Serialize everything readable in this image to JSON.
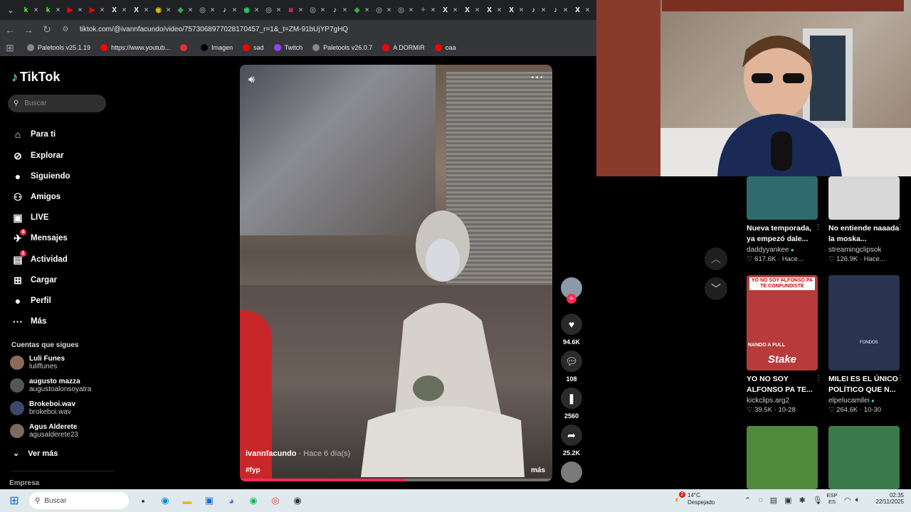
{
  "browser": {
    "tabs": [
      {
        "icon": "k",
        "color": "#53fc18"
      },
      {
        "icon": "k",
        "color": "#53fc18"
      },
      {
        "icon": "▶",
        "color": "#ff0000"
      },
      {
        "icon": "▶",
        "color": "#ff0000"
      },
      {
        "icon": "X",
        "color": "#000"
      },
      {
        "icon": "X",
        "color": "#000"
      },
      {
        "icon": "◉",
        "color": "#e0c000"
      },
      {
        "icon": "◆",
        "color": "#2db34a"
      },
      {
        "icon": "◎",
        "color": "#888"
      },
      {
        "icon": "♪",
        "color": "#000"
      },
      {
        "icon": "◉",
        "color": "#25d366"
      },
      {
        "icon": "◎",
        "color": "#888"
      },
      {
        "icon": "◙",
        "color": "#d62976"
      },
      {
        "icon": "◎",
        "color": "#888"
      },
      {
        "icon": "♪",
        "color": "#000"
      },
      {
        "icon": "◆",
        "color": "#2db34a"
      },
      {
        "icon": "◎",
        "color": "#888"
      },
      {
        "icon": "◎",
        "color": "#888"
      },
      {
        "icon": "✦",
        "color": "#666"
      },
      {
        "icon": "X",
        "color": "#000"
      },
      {
        "icon": "X",
        "color": "#000"
      },
      {
        "icon": "X",
        "color": "#000"
      },
      {
        "icon": "X",
        "color": "#000"
      },
      {
        "icon": "♪",
        "color": "#000"
      },
      {
        "icon": "♪",
        "color": "#000"
      },
      {
        "icon": "X",
        "color": "#000"
      }
    ],
    "url": "tiktok.com/@ivannfacundo/video/7573068977028170457_r=1&_t=ZM-91bUjYP7gHQ",
    "bookmarks": [
      {
        "label": "Paletools v25.1.19",
        "color": "#888"
      },
      {
        "label": "https://www.youtub...",
        "color": "#ff0000"
      },
      {
        "label": "",
        "color": "#e03030"
      },
      {
        "label": "Imagen",
        "color": "#000"
      },
      {
        "label": "sad",
        "color": "#ff0000"
      },
      {
        "label": "Twitch",
        "color": "#9146ff"
      },
      {
        "label": "Paletools v26.0.7",
        "color": "#888"
      },
      {
        "label": "A DORMIR",
        "color": "#ff0000"
      },
      {
        "label": "oaa",
        "color": "#ff0000"
      }
    ]
  },
  "sidebar": {
    "logo": "TikTok",
    "search_placeholder": "Buscar",
    "nav": [
      {
        "label": "Para ti",
        "icon": "⌂",
        "name": "home"
      },
      {
        "label": "Explorar",
        "icon": "⊘",
        "name": "explore"
      },
      {
        "label": "Siguiendo",
        "icon": "●",
        "name": "following"
      },
      {
        "label": "Amigos",
        "icon": "⚇",
        "name": "friends"
      },
      {
        "label": "LIVE",
        "icon": "▣",
        "name": "live"
      },
      {
        "label": "Mensajes",
        "icon": "✈",
        "name": "messages",
        "badge": "4"
      },
      {
        "label": "Actividad",
        "icon": "▤",
        "name": "activity",
        "badge": "1"
      },
      {
        "label": "Cargar",
        "icon": "⊞",
        "name": "upload"
      },
      {
        "label": "Perfil",
        "icon": "●",
        "name": "profile"
      },
      {
        "label": "Más",
        "icon": "···",
        "name": "more"
      }
    ],
    "following_title": "Cuentas que sigues",
    "accounts": [
      {
        "name": "Luli Funes",
        "handle": "luliffunes",
        "color": "#8a6a5a"
      },
      {
        "name": "augusto mazza",
        "handle": "augustoalonsoyatra",
        "color": "#555"
      },
      {
        "name": "Brokeboi.wav",
        "handle": "brokeboi.wav",
        "color": "#3b4a6a"
      },
      {
        "name": "Agus Alderete",
        "handle": "agusalderete23",
        "color": "#7a6a60"
      }
    ],
    "see_more": "Ver más",
    "empresa": "Empresa"
  },
  "video": {
    "user": "ivannfacundo",
    "time": "· Hace 6 día(s)",
    "tag": "#fyp",
    "more": "más",
    "progress": 0.53
  },
  "rail": {
    "likes": "94.6K",
    "comments": "108",
    "saves": "2560",
    "shares": "25.2K"
  },
  "feed": [
    {
      "title": "Nueva temporada, ya empezó dale...",
      "author": "daddyyankee",
      "verified": true,
      "views": "617.6K",
      "date": "Hace...",
      "thumb": "#2e6a6e"
    },
    {
      "title": "No entiende naaada la moska...",
      "author": "streamingclipsok",
      "verified": false,
      "views": "126.9K",
      "date": "Hace...",
      "thumb": "#d8d8d8"
    },
    {
      "title": "YO NO SOY ALFONSO PA TE...",
      "author": "kickclips.arg2",
      "verified": false,
      "views": "39.5K",
      "date": "10-28",
      "thumb": "#b83a3a"
    },
    {
      "title": "MILEI ES EL ÚNICO POLÍTICO QUE N...",
      "author": "elpelucamilei",
      "verified": true,
      "views": "264.6K",
      "date": "10-30",
      "thumb": "#2a3350"
    },
    {
      "title": "",
      "author": "",
      "verified": false,
      "views": "",
      "date": "",
      "thumb": "#4f8a3c"
    },
    {
      "title": "",
      "author": "",
      "verified": false,
      "views": "",
      "date": "",
      "thumb": "#3a7a4a"
    }
  ],
  "thumb_text": {
    "c3_top": "YO NO SOY ALFONSO PA TE CONFUNDISTE",
    "c3_mid": "NANDO A FULL",
    "c3_brand": "Stake",
    "c4_tag": "FONDOS"
  },
  "taskbar": {
    "search": "Buscar",
    "temp": "14°C",
    "weather": "Despejado",
    "weather_badge": "2",
    "lang1": "ESP",
    "lang2": "ES",
    "time": "02:35",
    "date": "22/11/2025"
  }
}
